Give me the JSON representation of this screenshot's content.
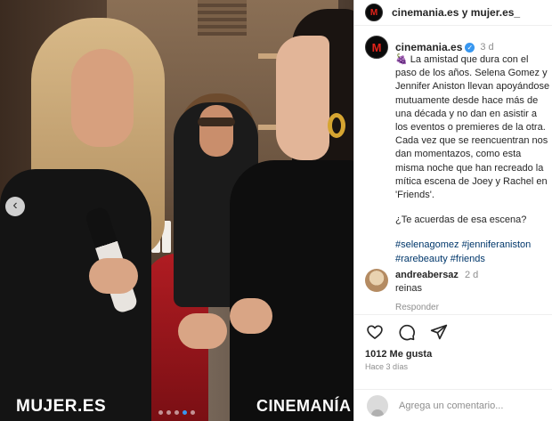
{
  "post": {
    "brand_left": "MUJER.ES",
    "brand_right": "CINEMANÍA",
    "carousel_dots": 5,
    "active_dot": 4,
    "prev_arrow_icon": "chevron-left-icon"
  },
  "header": {
    "logo_letter": "M",
    "accounts": "cinemania.es y mujer.es_"
  },
  "caption": {
    "username": "cinemania.es",
    "time": "3 d",
    "lines": [
      "🍇 La amistad que dura con el paso de los años. Selena Gomez y Jennifer Aniston llevan apoyándose mutuamente desde hace más de una década y no dan en asistir a los eventos o premieres de la otra. Cada vez que se reencuentran nos dan momentazos, como esta misma noche que han recreado la mítica escena de Joey y Rachel en 'Friends'."
    ],
    "question": "¿Te acuerdas de esa escena?",
    "hashtags": [
      "#selenagomez",
      "#jenniferaniston",
      "#rarebeauty",
      "#friends"
    ]
  },
  "comment": {
    "username": "andreabersaz",
    "time": "2 d",
    "text": "reinas",
    "reply_label": "Responder"
  },
  "actions": {
    "likes": "1012 Me gusta",
    "date": "Hace 3 días"
  },
  "composer": {
    "placeholder": "Agrega un comentario..."
  },
  "colors": {
    "link": "#00376b",
    "verified": "#3897f0",
    "brand_red": "#e2231a"
  }
}
